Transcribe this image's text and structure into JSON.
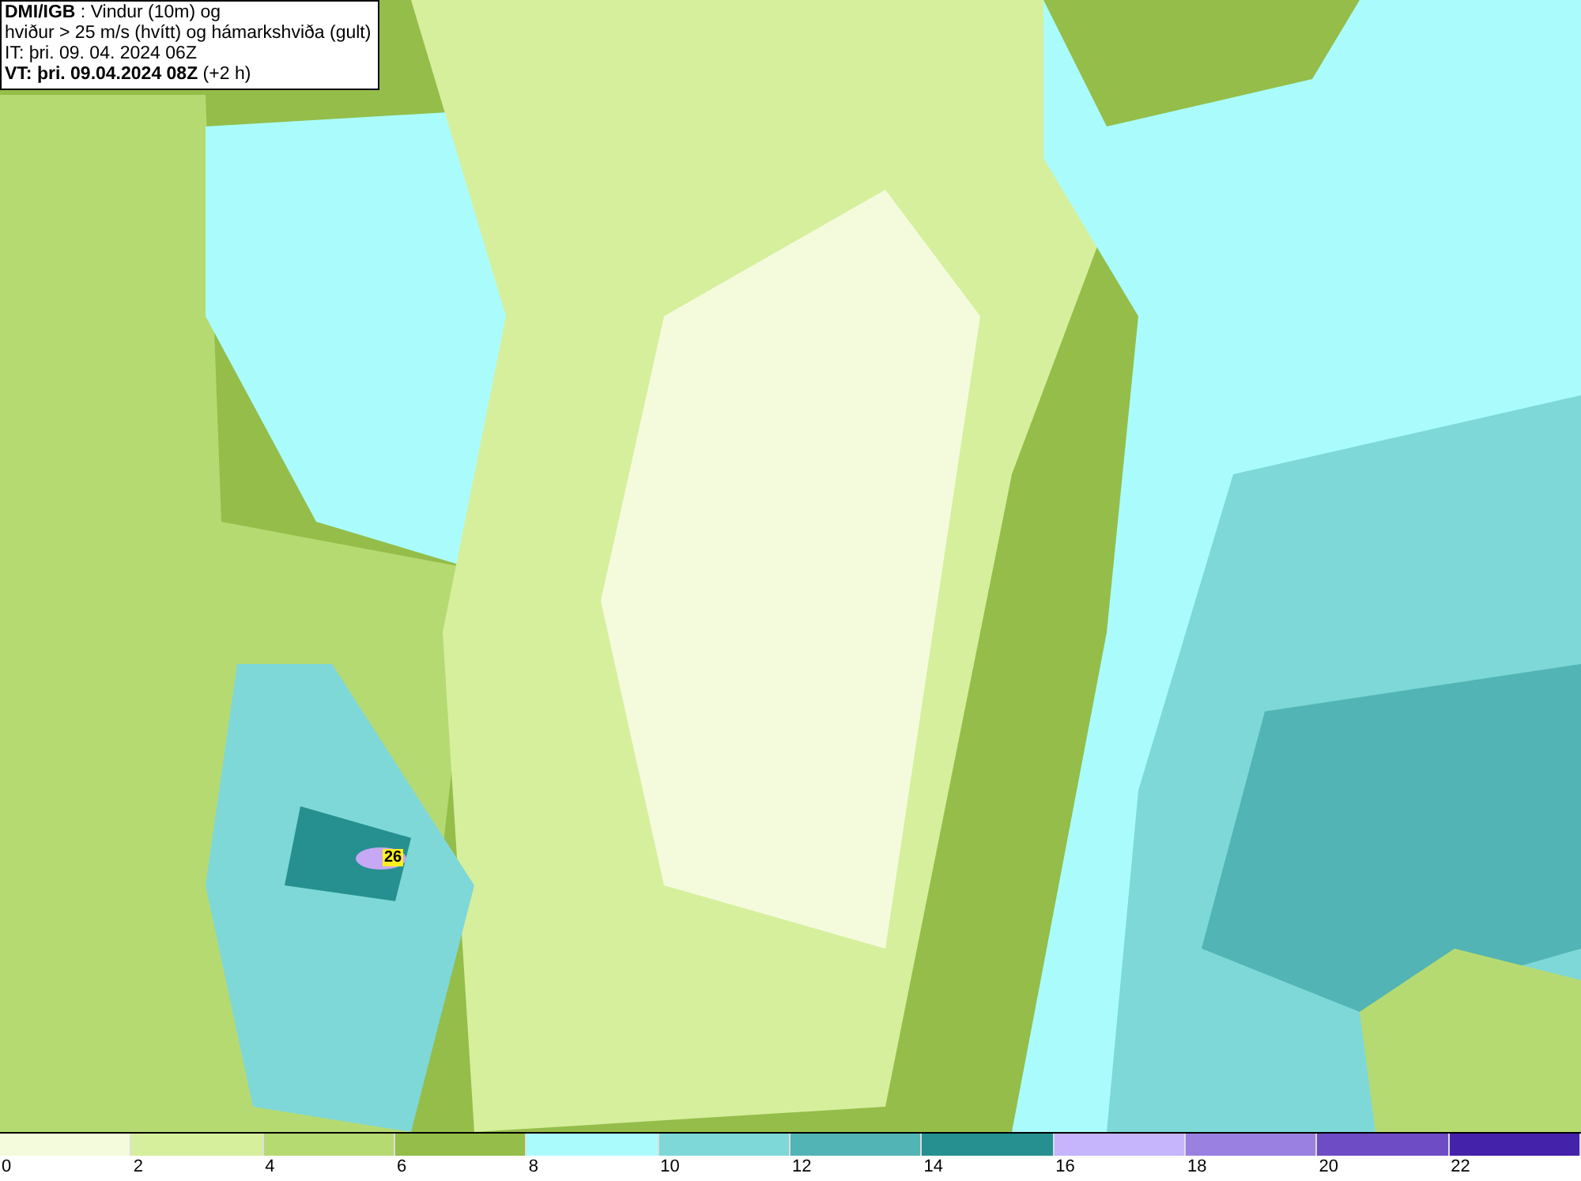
{
  "title_box": {
    "lines": [
      "**DMI/IGB** : Vindur (10m) og",
      "hviður > 25 m/s (hvítt) og hámarkshviða (gult)",
      "IT: þri. 09. 04. 2024 06Z",
      "**VT: þri. 09.04.2024 08Z** (+2 h)"
    ]
  },
  "gust_marker": {
    "value": "26"
  },
  "legend": [
    {
      "label": "0",
      "color": "#f4fbdc"
    },
    {
      "label": "2",
      "color": "#d6ef9c"
    },
    {
      "label": "4",
      "color": "#b6da72"
    },
    {
      "label": "6",
      "color": "#94bd4a"
    },
    {
      "label": "8",
      "color": "#aafcfc"
    },
    {
      "label": "10",
      "color": "#7ed8d8"
    },
    {
      "label": "12",
      "color": "#52b4b4"
    },
    {
      "label": "14",
      "color": "#25908f"
    },
    {
      "label": "16",
      "color": "#c6b4fc"
    },
    {
      "label": "18",
      "color": "#9a80e0"
    },
    {
      "label": "20",
      "color": "#6e4cc6"
    },
    {
      "label": "22",
      "color": "#4422aa"
    }
  ]
}
